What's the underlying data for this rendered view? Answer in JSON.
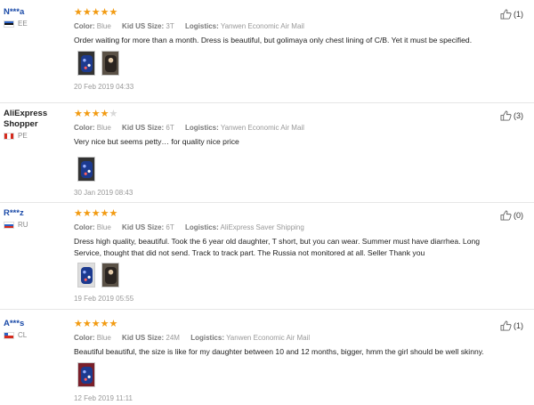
{
  "reviews": [
    {
      "user": "N***a",
      "country": "EE",
      "stars": 5,
      "color_label": "Color:",
      "color": "Blue",
      "size_label": "Kid US Size:",
      "size": "3T",
      "logistics_label": "Logistics:",
      "logistics": "Yanwen Economic Air Mail",
      "text": "Order waiting for more than a month. Dress is beautiful, but golimaya only chest lining of C/B. Yet it must be specified.",
      "photos": 2,
      "date": "20 Feb 2019 04:33",
      "helpful": "(1)"
    },
    {
      "user": "AliExpress Shopper",
      "country": "PE",
      "stars": 4,
      "color_label": "Color:",
      "color": "Blue",
      "size_label": "Kid US Size:",
      "size": "6T",
      "logistics_label": "Logistics:",
      "logistics": "Yanwen Economic Air Mail",
      "text": "Very nice but seems petty… for quality nice price",
      "photos": 1,
      "date": "30 Jan 2019 08:43",
      "helpful": "(3)"
    },
    {
      "user": "R***z",
      "country": "RU",
      "stars": 5,
      "color_label": "Color:",
      "color": "Blue",
      "size_label": "Kid US Size:",
      "size": "6T",
      "logistics_label": "Logistics:",
      "logistics": "AliExpress Saver Shipping",
      "text": "Dress high quality, beautiful. Took the 6 year old daughter, T short, but you can wear. Summer must have diarrhea. Long Service, thought that did not send. Track to track part. The Russia not monitored at all. Seller Thank you",
      "photos": 2,
      "date": "19 Feb 2019 05:55",
      "helpful": "(0)"
    },
    {
      "user": "A***s",
      "country": "CL",
      "stars": 5,
      "color_label": "Color:",
      "color": "Blue",
      "size_label": "Kid US Size:",
      "size": "24M",
      "logistics_label": "Logistics:",
      "logistics": "Yanwen Economic Air Mail",
      "text": "Beautiful beautiful, the size is like for my daughter between 10 and 12 months, bigger, hmm the girl should be well skinny.",
      "photos": 1,
      "date": "12 Feb 2019 11:11",
      "helpful": "(1)"
    }
  ],
  "colors": {
    "star": "#f29b12",
    "username": "#1a4aa8",
    "muted": "#999999"
  },
  "icons": {
    "helpful": "thumbs-up-icon",
    "star": "star-icon"
  }
}
